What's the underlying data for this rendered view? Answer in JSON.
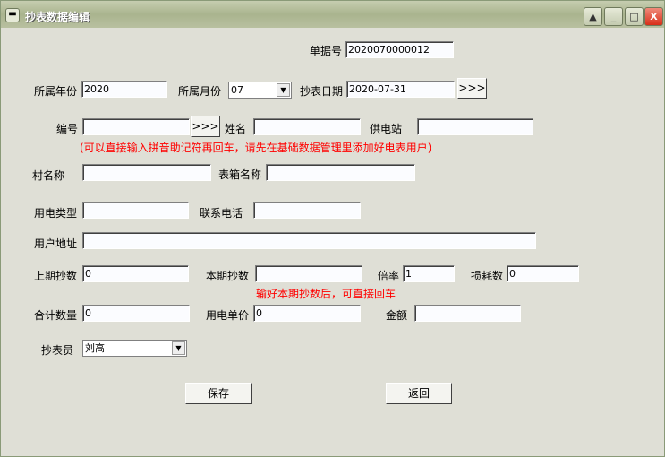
{
  "window": {
    "title": "抄表数据编辑"
  },
  "form": {
    "bill_no_label": "单据号",
    "bill_no": "2020070000012",
    "year_label": "所属年份",
    "year": "2020",
    "month_label": "所属月份",
    "month": "07",
    "date_label": "抄表日期",
    "date": "2020-07-31",
    "pick_label": ">>>",
    "code_label": "编号",
    "code": "",
    "code_pick_label": ">>>",
    "name_label": "姓名",
    "name": "",
    "station_label": "供电站",
    "station": "",
    "hint1": "(可以直接输入拼音助记符再回车，请先在基础数据管理里添加好电表用户)",
    "village_label": "村名称",
    "village": "",
    "box_label": "表箱名称",
    "box": "",
    "type_label": "用电类型",
    "type": "",
    "phone_label": "联系电话",
    "phone": "",
    "address_label": "用户地址",
    "address": "",
    "prev_label": "上期抄数",
    "prev": "0",
    "curr_label": "本期抄数",
    "curr": "",
    "ratio_label": "倍率",
    "ratio": "1",
    "loss_label": "损耗数",
    "loss": "0",
    "hint2": "输好本期抄数后，可直接回车",
    "total_label": "合计数量",
    "total": "0",
    "price_label": "用电单价",
    "price": "0",
    "amount_label": "金额",
    "amount": "",
    "reader_label": "抄表员",
    "reader": "刘高"
  },
  "buttons": {
    "save": "保存",
    "back": "返回"
  }
}
